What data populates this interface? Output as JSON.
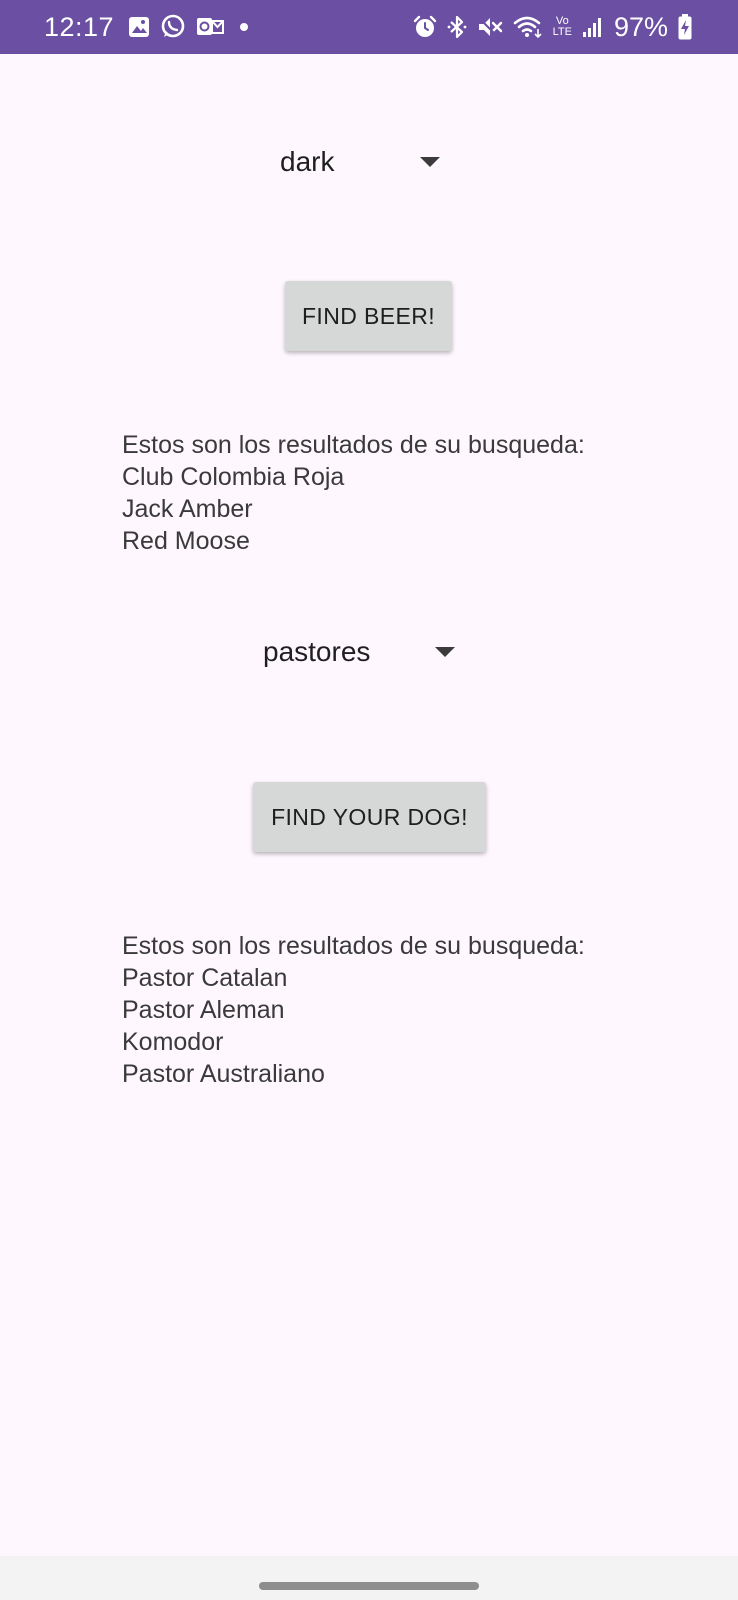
{
  "status_bar": {
    "time": "12:17",
    "battery": "97%",
    "background_color": "#6a4fa3",
    "left_icons": [
      "gallery-icon",
      "whatsapp-icon",
      "outlook-icon"
    ],
    "right_icons": [
      "alarm-icon",
      "bluetooth-icon",
      "mute-icon",
      "wifi-icon",
      "volte-icon",
      "signal-icon",
      "battery-charging-icon"
    ],
    "volte_label_top": "Vo",
    "volte_label_bottom": "LTE"
  },
  "beer": {
    "spinner_value": "dark",
    "button_label": "FIND BEER!",
    "results_header": "Estos son los resultados de su busqueda:",
    "results": [
      "Club Colombia Roja",
      "Jack Amber",
      "Red Moose"
    ]
  },
  "dog": {
    "spinner_value": "pastores",
    "button_label": "FIND YOUR DOG!",
    "results_header": "Estos son los resultados de su busqueda:",
    "results": [
      "Pastor Catalan",
      "Pastor Aleman",
      "Komodor",
      "Pastor Australiano"
    ]
  },
  "colors": {
    "page_background": "#fef7fe",
    "button_background": "#d6d7d7"
  }
}
